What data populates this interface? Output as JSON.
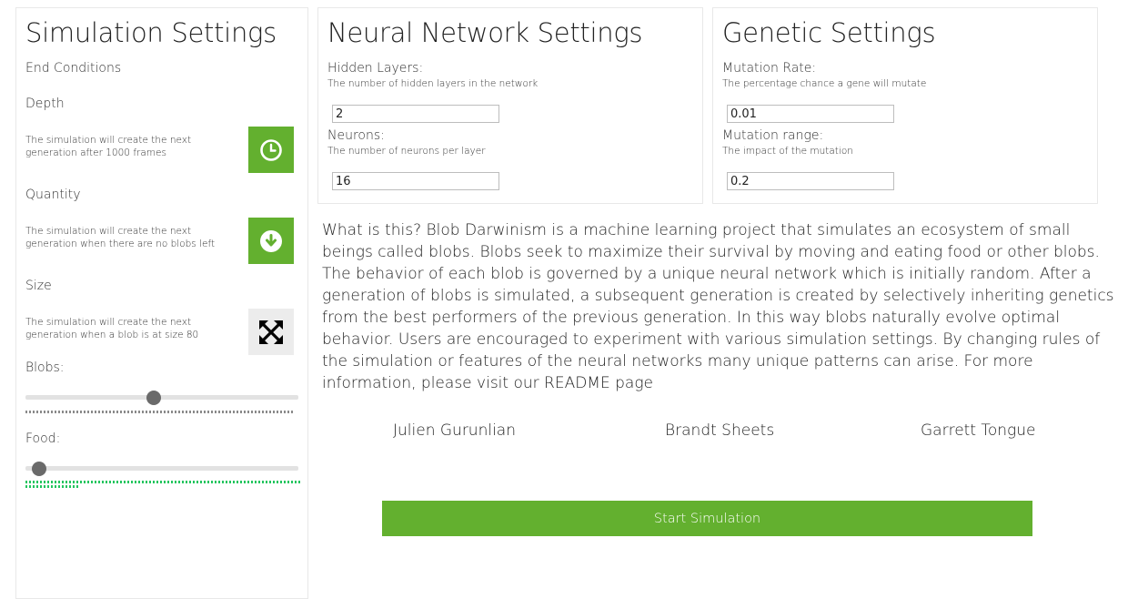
{
  "simulation": {
    "title": "Simulation Settings",
    "end_conditions_label": "End Conditions",
    "options": [
      {
        "label": "Depth",
        "description": "The simulation will create the next generation after 1000 frames",
        "icon": "clock-icon",
        "active": true
      },
      {
        "label": "Quantity",
        "description": "The simulation will create the next generation when there are no blobs left",
        "icon": "arrow-down-circle-icon",
        "active": true
      },
      {
        "label": "Size",
        "description": "The simulation will create the next generation when a blob is at size 80",
        "icon": "expand-arrows-icon",
        "active": false
      }
    ],
    "blobs_label": "Blobs:",
    "blobs_level": 0.47,
    "food_label": "Food:",
    "food_level": 0.05
  },
  "neural": {
    "title": "Neural Network Settings",
    "hidden_layers_label": "Hidden Layers:",
    "hidden_layers_hint": "The number of hidden layers in the network",
    "hidden_layers_value": "2",
    "neurons_label": "Neurons:",
    "neurons_hint": "The number of neurons per layer",
    "neurons_value": "16"
  },
  "genetic": {
    "title": "Genetic Settings",
    "mutation_rate_label": "Mutation Rate:",
    "mutation_rate_hint": "The percentage chance a gene will mutate",
    "mutation_rate_value": "0.01",
    "mutation_range_label": "Mutation range:",
    "mutation_range_hint": "The impact of the mutation",
    "mutation_range_value": "0.2"
  },
  "about": {
    "text": "What is this? Blob Darwinism is a machine learning project that simulates an ecosystem of small beings called blobs. Blobs seek to maximize their survival by moving and eating food or other blobs. The behavior of each blob is governed by a unique neural network which is initially random. After a generation of blobs is simulated, a subsequent generation is created by selectively inheriting genetics from the best performers of the previous generation. In this way blobs naturally evolve optimal behavior. Users are encouraged to experiment with various simulation settings. By changing rules of the simulation or features of the neural networks many unique patterns can arise. For more information, please visit our README page"
  },
  "authors": [
    "Julien Gurunlian",
    "Brandt Sheets",
    "Garrett Tongue"
  ],
  "start_label": "Start Simulation",
  "colors": {
    "accent": "#63b02f",
    "food_dots": "#22c55e",
    "blob_dots": "#8a8a8a"
  }
}
